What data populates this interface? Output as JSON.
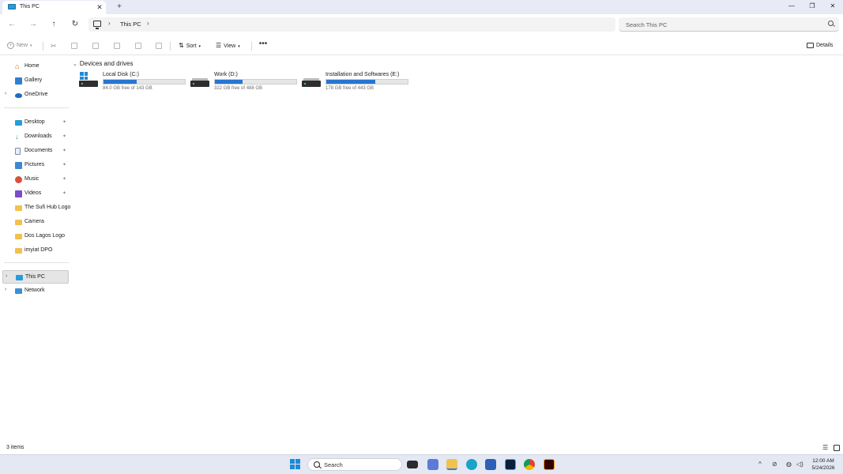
{
  "window": {
    "tab_title": "This PC",
    "close_tab": "✕",
    "new_tab": "+",
    "minimize": "—",
    "restore": "❐",
    "close": "✕"
  },
  "nav": {
    "back": "←",
    "forward": "→",
    "up": "↑",
    "refresh": "↻",
    "breadcrumb": "This PC",
    "separator": "›",
    "search_placeholder": "Search This PC"
  },
  "toolbar": {
    "new_label": "New",
    "sort_label": "Sort",
    "view_label": "View",
    "more_label": "•••",
    "details_label": "Details"
  },
  "sidebar": {
    "items": [
      {
        "label": "Home",
        "icon": "home-icon"
      },
      {
        "label": "Gallery",
        "icon": "gallery-icon"
      },
      {
        "label": "OneDrive",
        "icon": "cloud-icon"
      },
      {
        "label": "Desktop",
        "icon": "desktop-icon"
      },
      {
        "label": "Downloads",
        "icon": "download-icon"
      },
      {
        "label": "Documents",
        "icon": "document-icon"
      },
      {
        "label": "Pictures",
        "icon": "picture-icon"
      },
      {
        "label": "Music",
        "icon": "music-icon"
      },
      {
        "label": "Videos",
        "icon": "video-icon"
      },
      {
        "label": "The Sufi Hub Logo",
        "icon": "folder-icon"
      },
      {
        "label": "Camera",
        "icon": "folder-icon"
      },
      {
        "label": "Dos Lagos Logo",
        "icon": "folder-icon"
      },
      {
        "label": "imyiat DPO",
        "icon": "folder-icon"
      },
      {
        "label": "This PC",
        "icon": "computer-icon"
      },
      {
        "label": "Network",
        "icon": "network-icon"
      }
    ],
    "pin_glyph": "📌",
    "chevron": "›"
  },
  "content": {
    "section_title": "Devices and drives",
    "drives": [
      {
        "name": "Local Disk (C:)",
        "free": "84.0 GB free of 143 GB",
        "used_fraction": 0.41
      },
      {
        "name": "Work (D:)",
        "free": "322 GB free of 488 GB",
        "used_fraction": 0.34
      },
      {
        "name": "Installation and Softwares (E:)",
        "free": "178 GB free of 443 GB",
        "used_fraction": 0.6
      }
    ]
  },
  "status": {
    "items_count": "3 items"
  },
  "taskbar": {
    "search_label": "Search",
    "time": "12:00 AM",
    "date": "5/24/2026",
    "chevron": "^"
  }
}
